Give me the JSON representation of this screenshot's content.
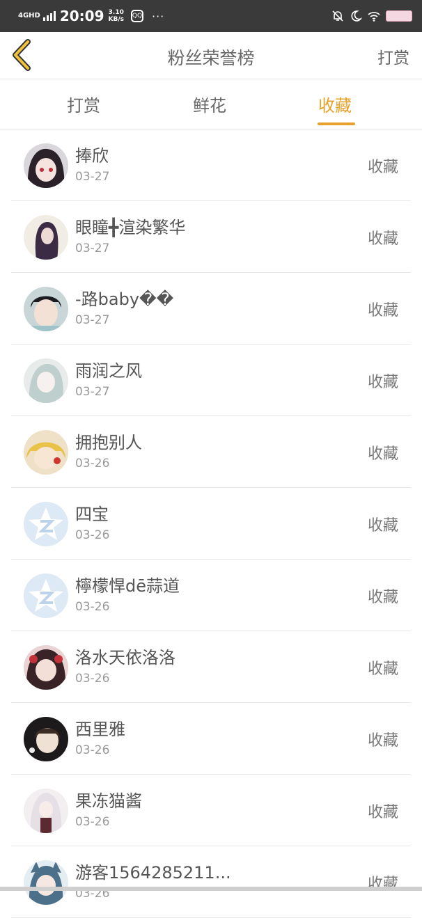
{
  "status": {
    "network": "4GHD",
    "time": "20:09",
    "speed_value": "3.10",
    "speed_unit": "KB/s",
    "qq": "QQ",
    "dots": "···"
  },
  "header": {
    "title": "粉丝荣誉榜",
    "action": "打赏"
  },
  "tabs": [
    {
      "label": "打赏",
      "active": false
    },
    {
      "label": "鲜花",
      "active": false
    },
    {
      "label": "收藏",
      "active": true
    }
  ],
  "colors": {
    "accent": "#e8a12a",
    "status_bar": "#3a3a3a"
  },
  "rows": [
    {
      "name": "捧欣",
      "date": "03-27",
      "action": "收藏",
      "avatar": "anime-girl-dark-hair"
    },
    {
      "name": "眼瞳╋渲染繁华",
      "date": "03-27",
      "action": "收藏",
      "avatar": "girl-long-hair"
    },
    {
      "name": "-路baby��",
      "date": "03-27",
      "action": "收藏",
      "avatar": "boy-photo"
    },
    {
      "name": "雨润之风",
      "date": "03-27",
      "action": "收藏",
      "avatar": "anime-girl-light"
    },
    {
      "name": "拥抱别人",
      "date": "03-26",
      "action": "收藏",
      "avatar": "anime-blonde"
    },
    {
      "name": "四宝",
      "date": "03-26",
      "action": "收藏",
      "avatar": "default-star"
    },
    {
      "name": "檸檬悍dē蒜道",
      "date": "03-26",
      "action": "收藏",
      "avatar": "default-star"
    },
    {
      "name": "洛水天依洛洛",
      "date": "03-26",
      "action": "收藏",
      "avatar": "anime-red"
    },
    {
      "name": "西里雅",
      "date": "03-26",
      "action": "收藏",
      "avatar": "anime-dark"
    },
    {
      "name": "果冻猫酱",
      "date": "03-26",
      "action": "收藏",
      "avatar": "anime-white-hair"
    },
    {
      "name": "游客1564285211...",
      "date": "03-26",
      "action": "收藏",
      "avatar": "anime-cat-ears"
    }
  ]
}
